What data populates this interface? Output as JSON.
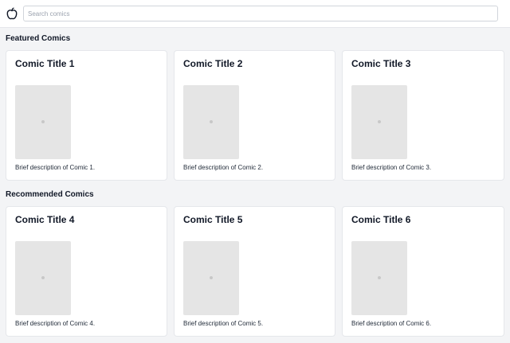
{
  "header": {
    "logo_icon": "apple-icon",
    "search_placeholder": "Search comics",
    "search_value": ""
  },
  "sections": {
    "featured": {
      "title": "Featured Comics",
      "comics": [
        {
          "title": "Comic Title 1",
          "description": "Brief description of Comic 1."
        },
        {
          "title": "Comic Title 2",
          "description": "Brief description of Comic 2."
        },
        {
          "title": "Comic Title 3",
          "description": "Brief description of Comic 3."
        }
      ]
    },
    "recommended": {
      "title": "Recommended Comics",
      "comics": [
        {
          "title": "Comic Title 4",
          "description": "Brief description of Comic 4."
        },
        {
          "title": "Comic Title 5",
          "description": "Brief description of Comic 5."
        },
        {
          "title": "Comic Title 6",
          "description": "Brief description of Comic 6."
        }
      ]
    }
  },
  "colors": {
    "page_background": "#f3f4f6",
    "card_background": "#ffffff",
    "thumbnail_placeholder": "#e5e5e5"
  }
}
